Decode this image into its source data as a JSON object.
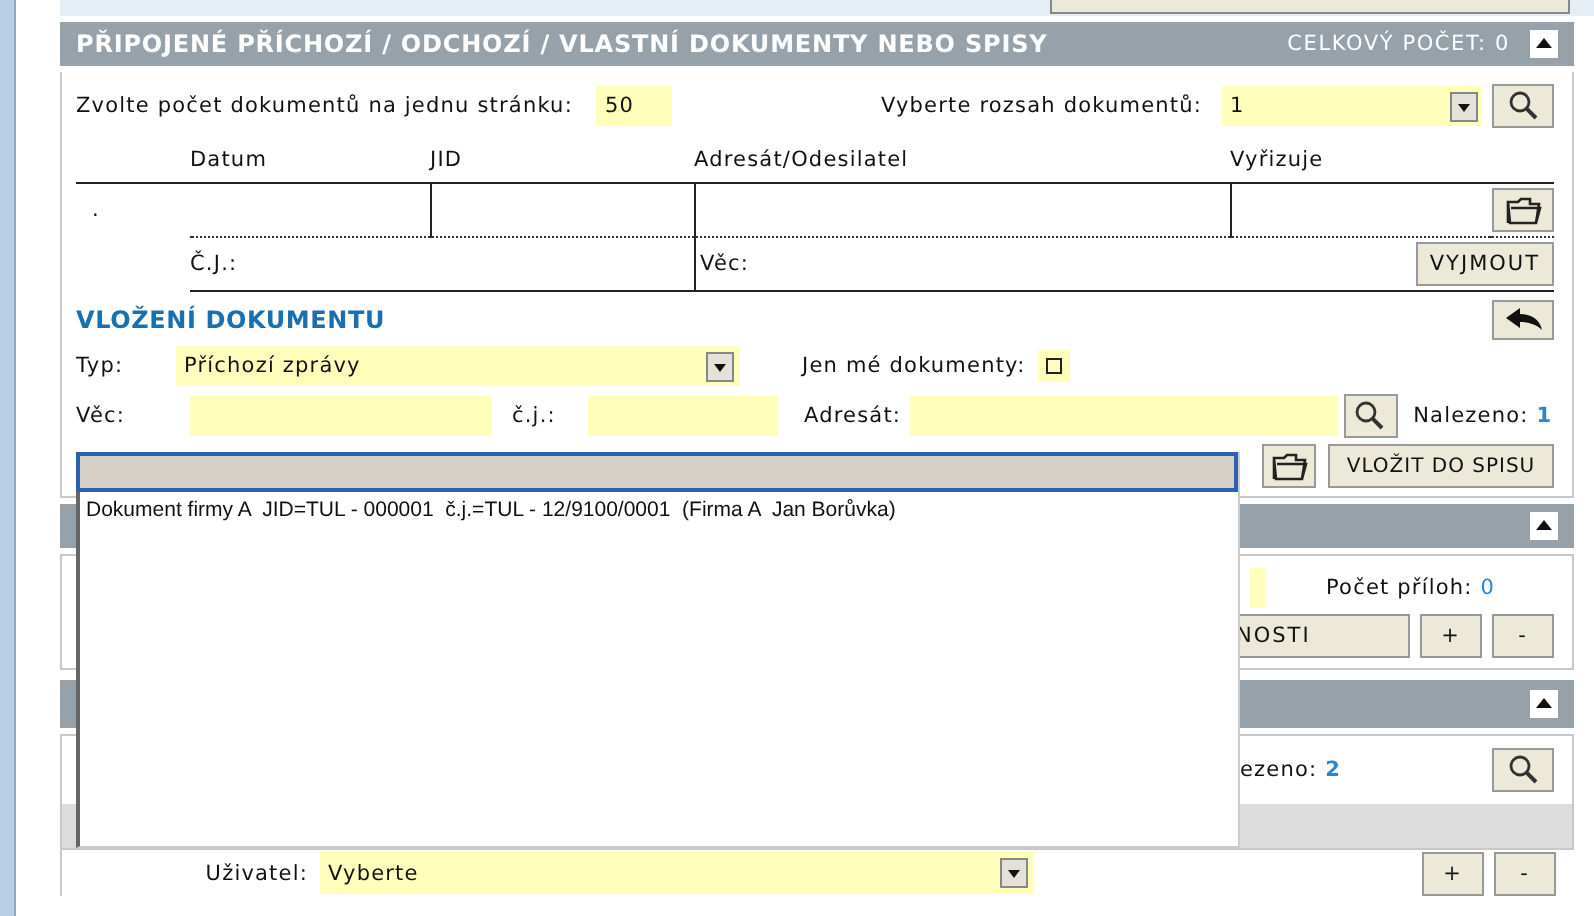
{
  "attached_section": {
    "title": "PŘIPOJENÉ PŘÍCHOZÍ / ODCHOZÍ / VLASTNÍ DOKUMENTY NEBO SPISY",
    "total": "CELKOVÝ POČET: 0",
    "page_size_label": "Zvolte počet dokumentů na jednu stránku:",
    "page_size": "50",
    "range_label": "Vyberte rozsah dokumentů:",
    "range_value": "1",
    "columns": [
      "Datum",
      "JID",
      "Adresát/Odesilatel",
      "Vyřizuje"
    ],
    "rows": [
      {
        "marker": ".",
        "cj_label": "Č.J.:",
        "subject_label": "Věc:"
      }
    ],
    "remove_button": "VYJMOUT"
  },
  "insert_section": {
    "title": "VLOŽENÍ DOKUMENTU",
    "type_label": "Typ:",
    "type_value": "Příchozí zprávy",
    "mine_label": "Jen mé dokumenty:",
    "mine_checked": false,
    "subject_label": "Věc:",
    "cj_label": "č.j.:",
    "addressee_label": "Adresát:",
    "found_label": "Nalezeno:",
    "found_count": "1",
    "insert_button": "VLOŽIT DO SPISU"
  },
  "autocomplete": {
    "suggestions": [
      "Dokument firmy A  JID=TUL - 000001  č.j.=TUL - 12/9100/0001  (Firma A  Jan Borůvka)"
    ]
  },
  "attachments_section": {
    "count_label": "Počet příloh:",
    "count": "0",
    "button_fragment": "NOSTI",
    "add_button": "+",
    "remove_button": "-"
  },
  "search_section": {
    "found_fragment": "ezeno:",
    "found_count": "2"
  },
  "user_row": {
    "label": "Uživatel:",
    "value": "Vyberte",
    "add_button": "+",
    "remove_button": "-"
  }
}
